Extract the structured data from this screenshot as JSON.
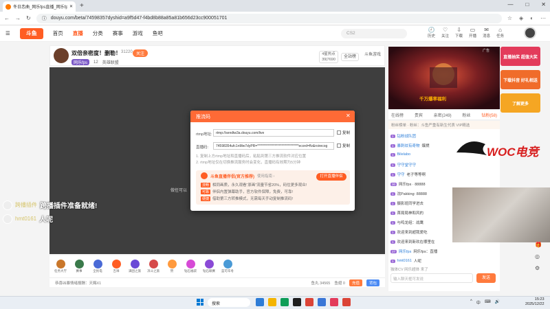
{
  "browser": {
    "tab_title": "冬日恋曲_网乐fps直播_网乐fps...",
    "new_tab": "+",
    "url": "douyu.com/beta/74598357dyshid=a9f5d47-f4bd8b88a85a81b656d23cc900051701",
    "window_controls": [
      "—",
      "□",
      "✕"
    ]
  },
  "nav": {
    "logo": "斗鱼",
    "items": [
      "首页",
      "直播",
      "分类",
      "赛事",
      "游戏",
      "鱼吧"
    ],
    "active_index": 1,
    "search_placeholder": "CS2",
    "icons": [
      {
        "glyph": "🕘",
        "label": "历史"
      },
      {
        "glyph": "♡",
        "label": "关注"
      },
      {
        "glyph": "⇩",
        "label": "下载"
      },
      {
        "glyph": "▭",
        "label": "开播"
      },
      {
        "glyph": "✉",
        "label": "消息"
      },
      {
        "glyph": "⌂",
        "label": "任务"
      }
    ]
  },
  "room": {
    "title": "双倍亲密度！删勒！",
    "id": "31220",
    "follow": "关注",
    "tag": "网乐fps",
    "meta_count": "12",
    "meta_link": "英雄联盟",
    "hot_label": "4星热点",
    "hot_value": "39|7690",
    "full_btn": "全站榜",
    "shop_label": "斗鱼游戏",
    "video_overlay": "做任可以"
  },
  "gifts": [
    {
      "label": "任务大厅",
      "color": "#c9772b"
    },
    {
      "label": "赛事",
      "color": "#3a7a4b"
    },
    {
      "label": "全民电",
      "color": "#4a6ad6"
    },
    {
      "label": "吉祥",
      "color": "#ff5d23"
    },
    {
      "label": "满团之旅",
      "color": "#6a4ad6"
    },
    {
      "label": "决斗之旅",
      "color": "#d64a4a"
    },
    {
      "label": "赞",
      "color": "#ff9a3d"
    },
    {
      "label": "钻石福袋",
      "color": "#d64ad6"
    },
    {
      "label": "钻石联赛",
      "color": "#8a4ad6"
    },
    {
      "label": "蓝可华冬",
      "color": "#4a9ad6"
    }
  ],
  "bottom": {
    "left_text": "恭喜凶暴情绪报酬：天赐X1",
    "fish": "鱼丸 34565",
    "gold": "鱼翅 0",
    "btn1": "充值",
    "btn2": "背包"
  },
  "ad": {
    "label": "广告",
    "caption": "千万爆率福利"
  },
  "side_ads": [
    {
      "text": "直播抽奖 超值大奖",
      "color": "#e33b5b"
    },
    {
      "text": "下载抖音 好礼相送",
      "color": "#f06c2a"
    },
    {
      "text": "了解更多",
      "color": "#f5a623"
    }
  ],
  "chat_tabs": {
    "items": [
      "在线榜",
      "贵宾",
      "亲密(249)",
      "粉丝",
      "钻粉(58)"
    ],
    "active_index": 4
  },
  "rank_row": "粉丝榜单 · 粉丝：斗鱼严重有新生代表 VIP精选",
  "watermark": "WOC电竞",
  "chat": [
    {
      "lv": "1",
      "name": "钻粉战队团",
      "text": ""
    },
    {
      "lv": "1",
      "name": "暴刺纹有奇物",
      "text": "爆燃"
    },
    {
      "lv": "1",
      "name": "Bilelabo",
      "text": ""
    },
    {
      "lv": "1",
      "name": "守守堂守守",
      "text": ""
    },
    {
      "lv": "1",
      "name": "守守",
      "text": "老子等等啊"
    },
    {
      "lv": "30",
      "name": "",
      "text": "网乐fps · 88888"
    },
    {
      "lv": "1",
      "name": "",
      "text": "沈Pakking: 88888"
    },
    {
      "lv": "1",
      "name": "",
      "text": "摄影班同学进去"
    },
    {
      "lv": "1",
      "name": "",
      "text": "首局局神和风的"
    },
    {
      "lv": "1",
      "name": "",
      "text": "与鸣龙组：战鹰"
    },
    {
      "lv": "1",
      "name": "",
      "text": "欢迎来到超我爱吃"
    },
    {
      "lv": "1",
      "name": "",
      "text": "欢迎来到新欢在哪里在"
    },
    {
      "lv": "27",
      "name": "网乐fps",
      "text": "网乐fps：直播"
    },
    {
      "lv": "1",
      "name": "hmt0161",
      "text": "人呢"
    }
  ],
  "chat_tools": "独体CV 网乐超体  来了",
  "chat_input_placeholder": "输入聊天框可发说",
  "send": "发送",
  "danmaku": [
    {
      "name": "跨播插件",
      "text": "跨播插件准备就绪!"
    },
    {
      "name": "hmt0161",
      "text": "人呢"
    }
  ],
  "modal": {
    "title": "推流码",
    "close": "✕",
    "rtmp_label": "rtmp地址:",
    "rtmp_value": "rtmp://sendtw3a.douyu.com/live",
    "key_label": "直播码:",
    "key_value": "74598354ufc1nMw7dyPR=*******************************ecord=flv&roirecog",
    "copy": "复制",
    "tips": [
      "1. 复制上方rtmp地址和直播码后，粘贴到第三方推流软件对应位置",
      "2. rtmp地址仅在切换推流服务时会变化，直播码有效期为5分钟"
    ],
    "promo_title": "斗鱼直播伴侣(官方推荐)",
    "promo_sub": "使用指南 ›",
    "promo_lines": [
      {
        "k": "流畅",
        "text": "相同画质，永久观看“原画”流量节省20%，码住更多观众!"
      },
      {
        "k": "可靠",
        "text": "伴侣内置弹幕助手，官方软件保障，免费，可靠!"
      },
      {
        "k": "便捷",
        "text": "借助第三方转推模式，无需每天手动复制推流码!"
      }
    ],
    "open_btn": "打开直播伴侣"
  },
  "taskbar": {
    "search": "搜索",
    "apps": [
      "#2d7cd6",
      "#f4b400",
      "#0f9d58",
      "#1e1e1e",
      "#db4437",
      "#3a76d6",
      "#e33b5b",
      "#db4437"
    ],
    "tray": [
      "^",
      "中",
      "⌨",
      "🔊"
    ],
    "time": "15:23",
    "date": "2025/12/22"
  }
}
